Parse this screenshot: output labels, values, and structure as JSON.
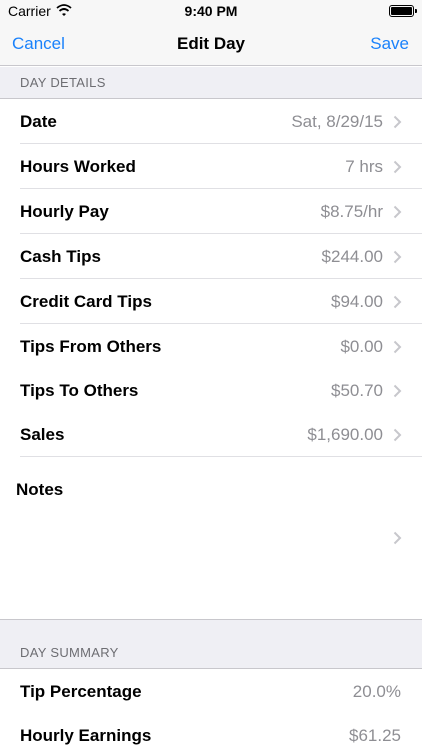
{
  "status_bar": {
    "carrier": "Carrier",
    "time": "9:40 PM",
    "icons": [
      "wifi-icon",
      "battery-icon"
    ]
  },
  "nav": {
    "cancel_label": "Cancel",
    "title": "Edit Day",
    "save_label": "Save"
  },
  "day_details": {
    "header": "DAY DETAILS",
    "rows": [
      {
        "label": "Date",
        "value": "Sat, 8/29/15"
      },
      {
        "label": "Hours Worked",
        "value": "7 hrs"
      },
      {
        "label": "Hourly Pay",
        "value": "$8.75/hr"
      },
      {
        "label": "Cash Tips",
        "value": "$244.00"
      },
      {
        "label": "Credit Card Tips",
        "value": "$94.00"
      },
      {
        "label": "Tips From Others",
        "value": "$0.00"
      },
      {
        "label": "Tips To Others",
        "value": "$50.70"
      },
      {
        "label": "Sales",
        "value": "$1,690.00"
      }
    ]
  },
  "notes": {
    "label": "Notes"
  },
  "day_summary": {
    "header": "DAY SUMMARY",
    "rows": [
      {
        "label": "Tip Percentage",
        "value": "20.0%"
      },
      {
        "label": "Hourly Earnings",
        "value": "$61.25"
      }
    ]
  },
  "colors": {
    "accent": "#1a82fb",
    "secondary_text": "#8e8e93",
    "grouped_background": "#efeff4"
  }
}
